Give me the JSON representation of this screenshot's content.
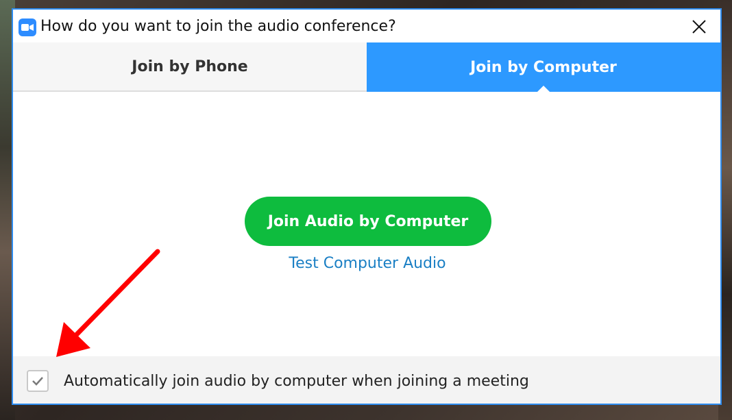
{
  "dialog": {
    "title": "How do you want to join the audio conference?",
    "app_icon": "zoom-camera-icon",
    "close_icon": "close-icon"
  },
  "tabs": [
    {
      "label": "Join by Phone",
      "selected": false
    },
    {
      "label": "Join by Computer",
      "selected": true
    }
  ],
  "main": {
    "join_button_label": "Join Audio by Computer",
    "test_link_label": "Test Computer Audio"
  },
  "footer": {
    "checkbox_checked": true,
    "checkbox_label": "Automatically join audio by computer when joining a meeting"
  },
  "colors": {
    "accent_blue": "#2d99ff",
    "join_green": "#0ebc3e",
    "link_blue": "#1a7fc4",
    "annotation_red": "#ff0000"
  }
}
